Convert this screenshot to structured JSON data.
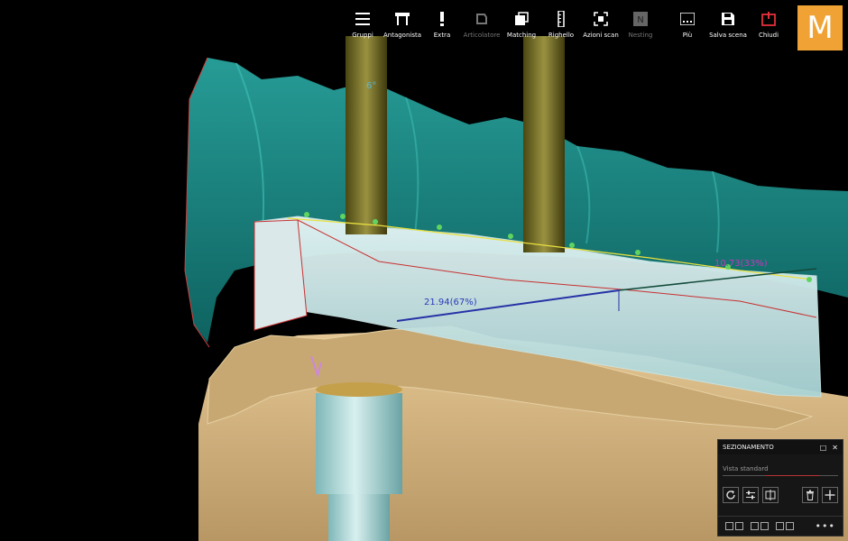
{
  "toolbar": {
    "items": [
      {
        "label": "Gruppi",
        "icon": "menu-icon",
        "enabled": true
      },
      {
        "label": "Antagonista",
        "icon": "antagonist-icon",
        "enabled": true
      },
      {
        "label": "Extra",
        "icon": "exclamation-icon",
        "enabled": true
      },
      {
        "label": "Articolatore",
        "icon": "articulator-icon",
        "enabled": false
      },
      {
        "label": "Matching",
        "icon": "matching-icon",
        "enabled": true
      },
      {
        "label": "Righello",
        "icon": "ruler-icon",
        "enabled": true
      },
      {
        "label": "Azioni scan",
        "icon": "scan-actions-icon",
        "enabled": true
      },
      {
        "label": "Nesting",
        "icon": "nesting-icon",
        "enabled": false
      }
    ],
    "right_items": [
      {
        "label": "Più",
        "icon": "more-icon"
      },
      {
        "label": "Salva scena",
        "icon": "save-icon"
      },
      {
        "label": "Chiudi",
        "icon": "power-icon"
      }
    ],
    "logo": "M"
  },
  "viewport": {
    "angle_label": "6°",
    "measure_left": "21.94(67%)",
    "measure_right": "10.73(33%)"
  },
  "panel": {
    "title": "SEZIONAMENTO",
    "view_placeholder": "Vista standard",
    "controls": {
      "restore": "□",
      "close": "✕"
    }
  },
  "colors": {
    "accent": "#f0a334",
    "teal": "#1b8f8a",
    "gum": "#d6b784",
    "implant": "#6b6521",
    "close_red": "#e0303a"
  }
}
